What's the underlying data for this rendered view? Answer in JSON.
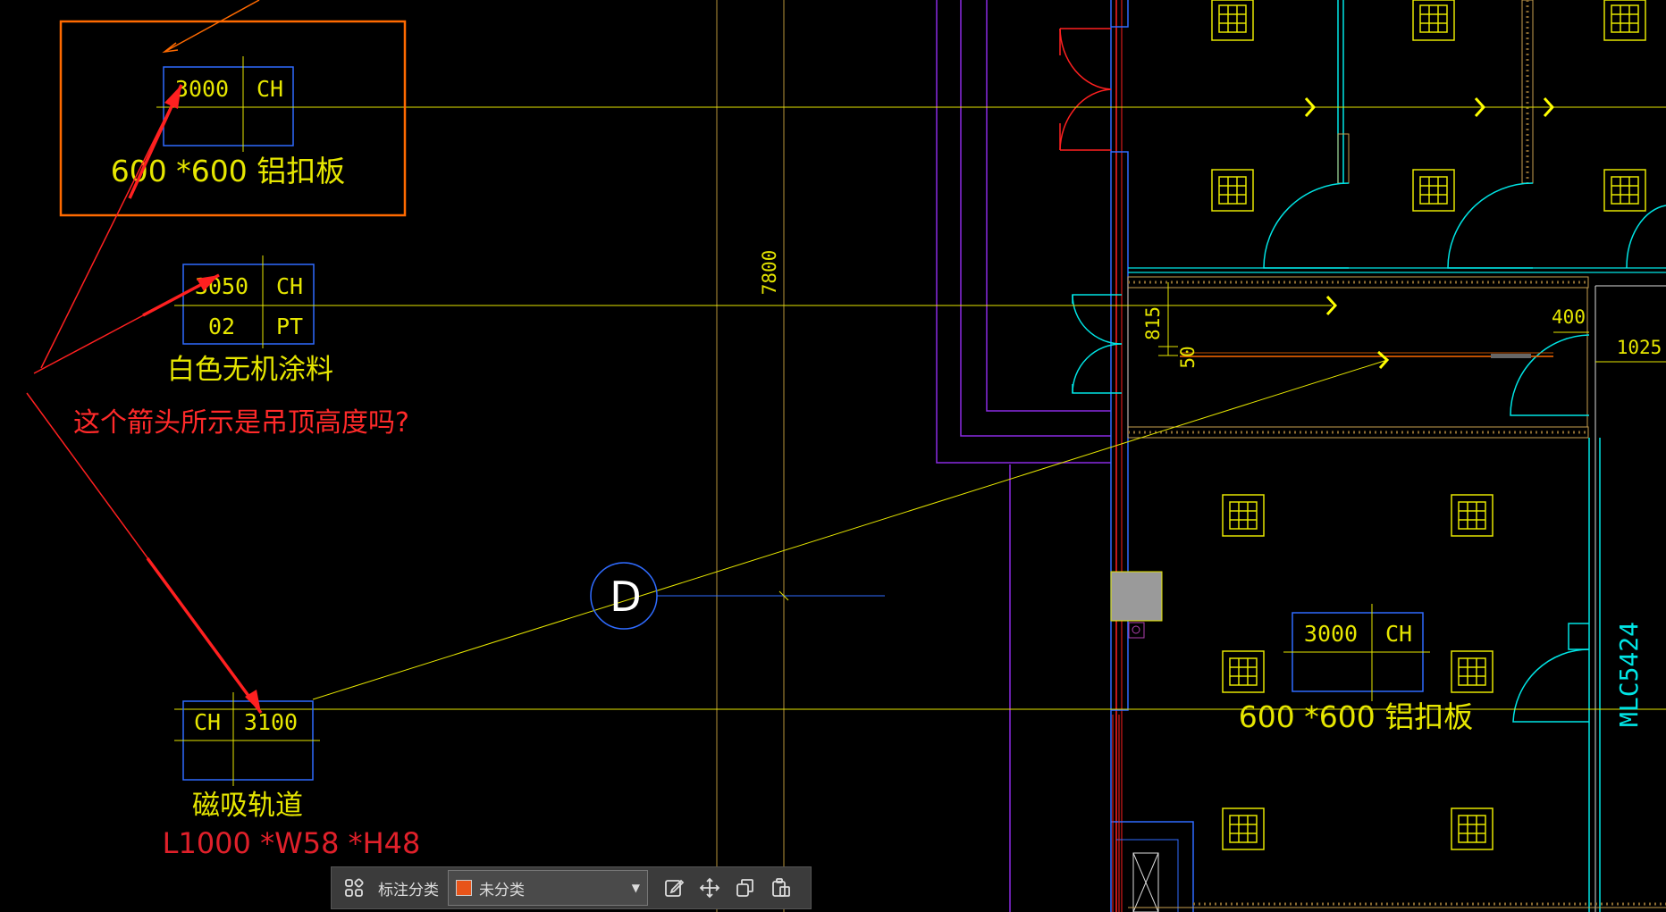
{
  "drawing": {
    "tags": {
      "tag_top": {
        "left": "3000",
        "right": "CH",
        "material": "600 *600 铝扣板"
      },
      "tag_paint": {
        "top_left": "3050",
        "top_right": "CH",
        "bottom_left": "02",
        "bottom_right": "PT",
        "material": "白色无机涂料"
      },
      "tag_rail": {
        "left": "CH",
        "right": "3100",
        "material": "磁吸轨道",
        "spec": "L1000 *W58 *H48"
      },
      "tag_room": {
        "left": "3000",
        "right": "CH",
        "material": "600 *600 铝扣板"
      }
    },
    "dimensions": {
      "d7800": "7800",
      "d815": "815",
      "d50": "50",
      "d400": "400",
      "d1025": "1025"
    },
    "grid_bubble": "D",
    "door_label": "MLC5424"
  },
  "annotation": {
    "question": "这个箭头所示是吊顶高度吗?",
    "color": "#ff2a2a"
  },
  "toolbar": {
    "category_label": "标注分类",
    "category_value": "未分类",
    "swatch_color": "#e8541a"
  },
  "colors": {
    "yellow": "#ffff00",
    "cad_yellow": "#e6e600",
    "cyan": "#00e5e5",
    "blue": "#2f6bff",
    "purple": "#8a2be2",
    "orange": "#ff6a00",
    "red": "#ff2020",
    "tan": "#c8a050"
  }
}
